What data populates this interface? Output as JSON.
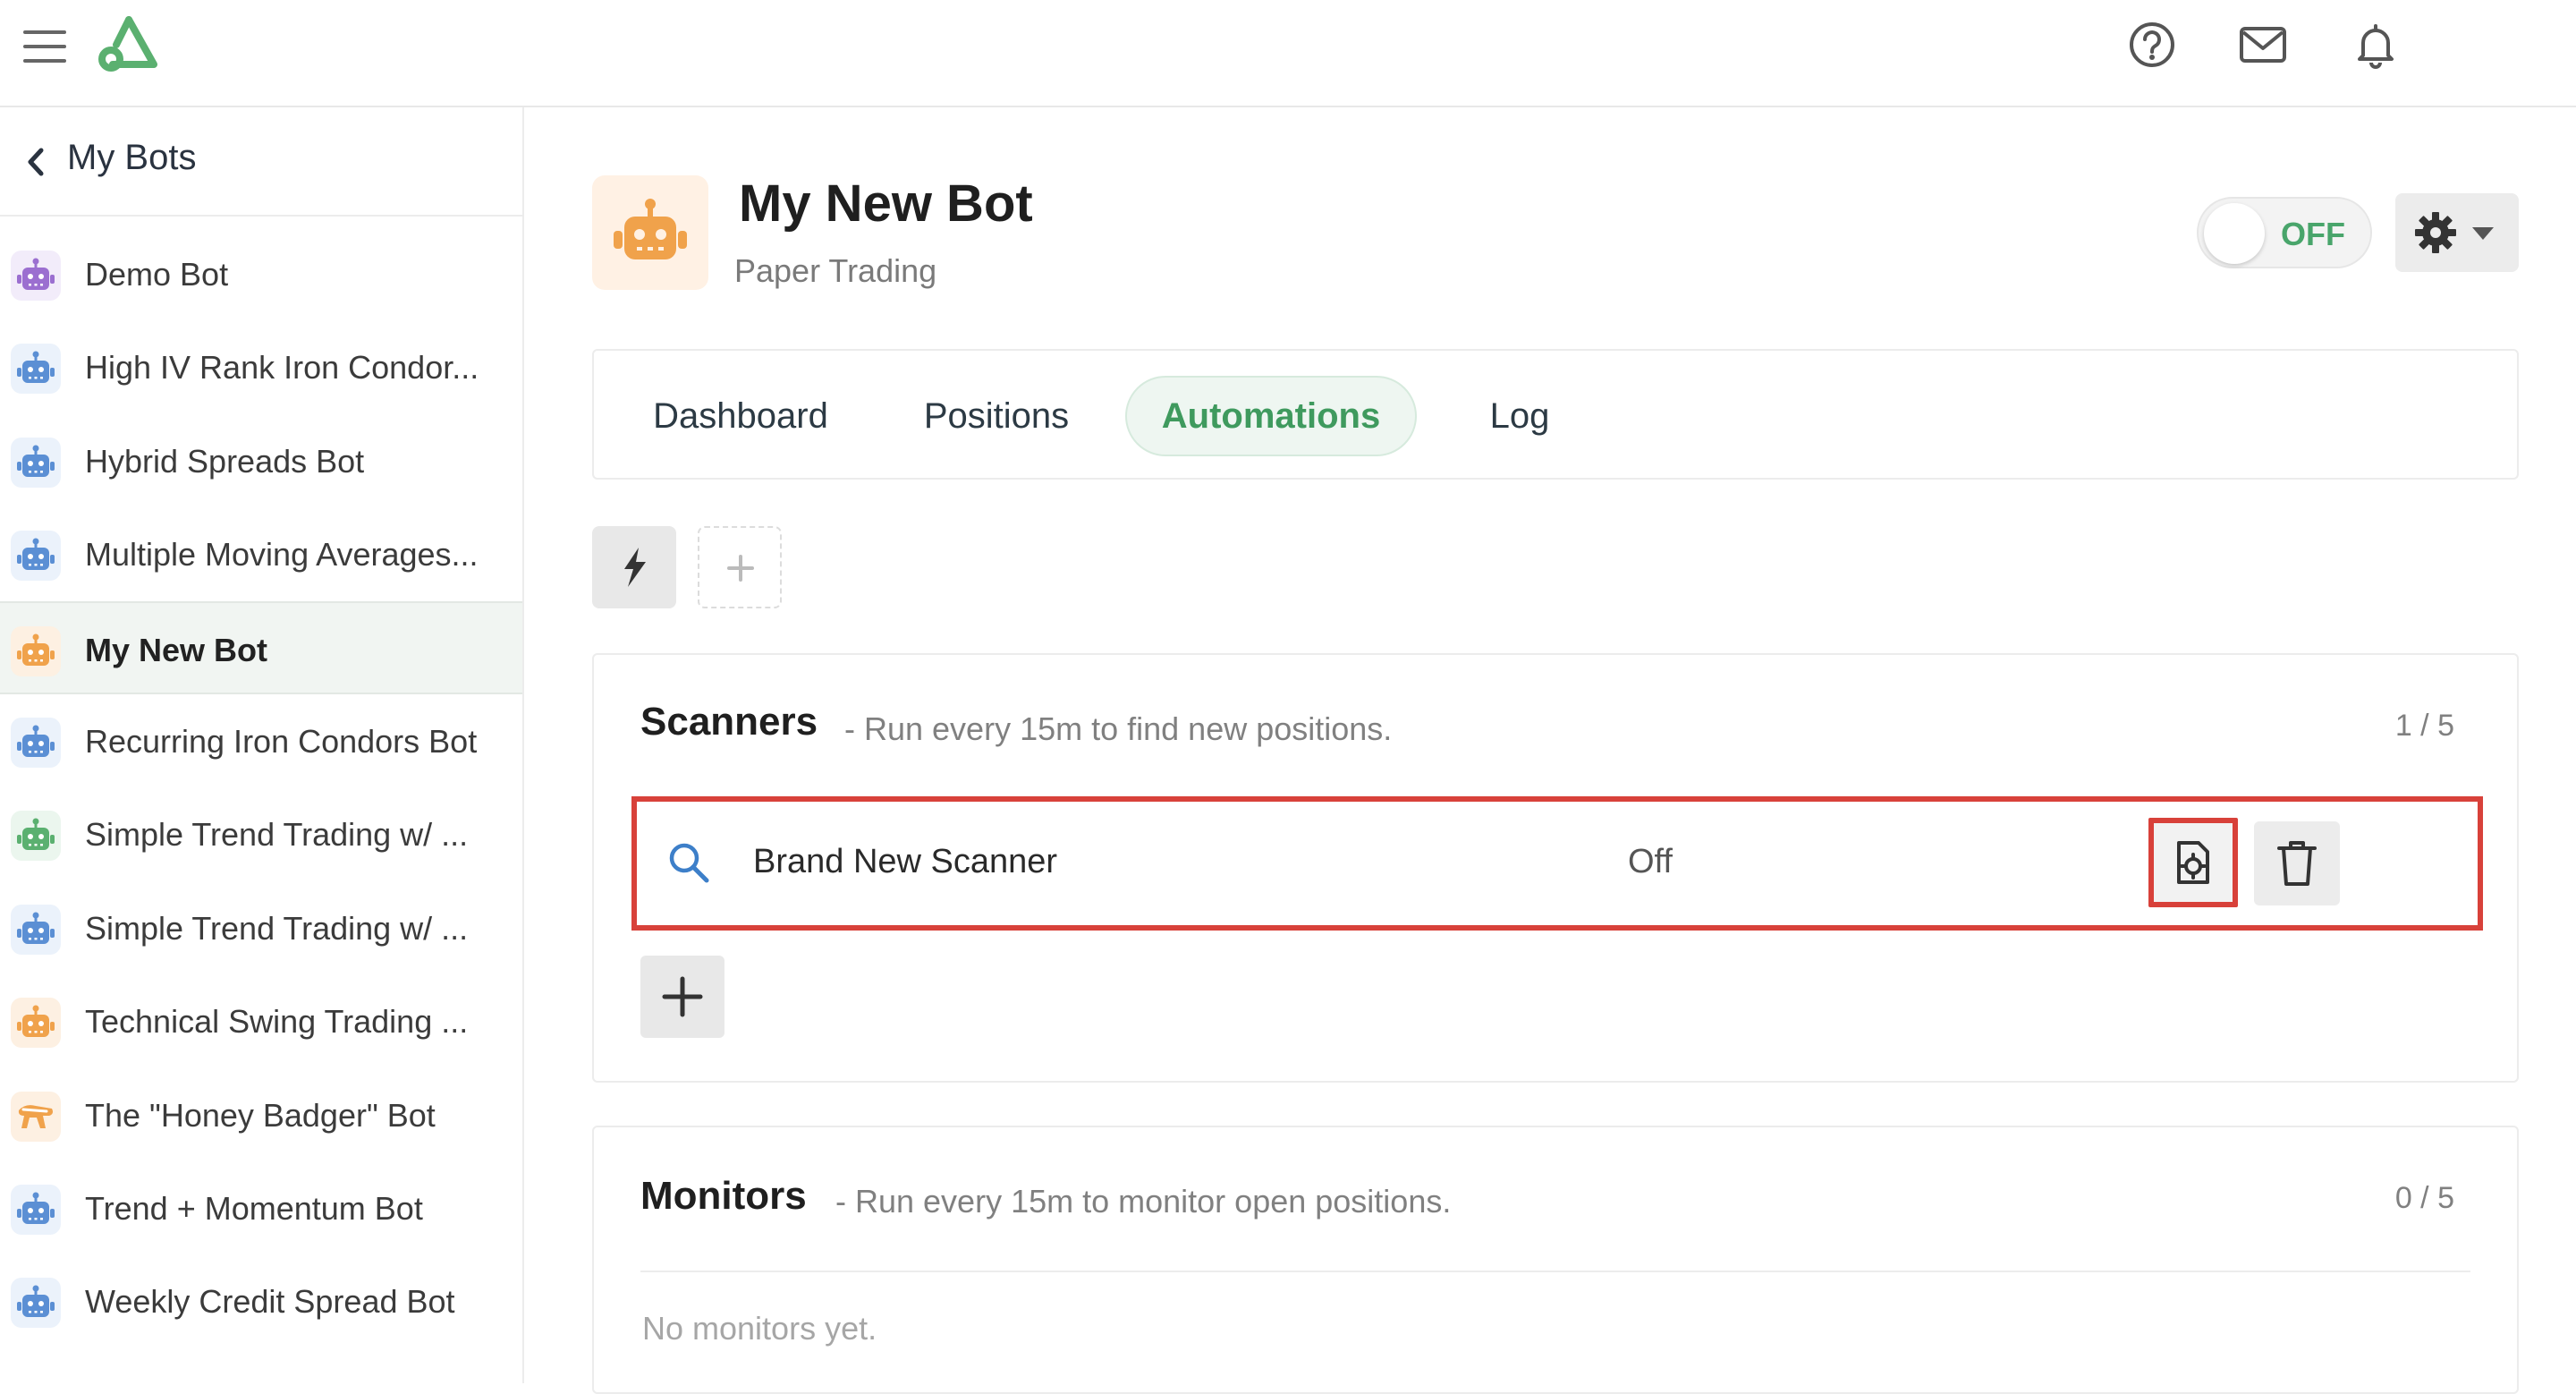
{
  "topbar": {
    "icons": [
      "menu-icon",
      "logo",
      "help-icon",
      "mail-icon",
      "bell-icon"
    ]
  },
  "sidebar": {
    "back_label": "My Bots",
    "items": [
      {
        "label": "Demo Bot",
        "icon": "robot-icon",
        "color": "#9b6fd0",
        "bg": "#f2ecfa"
      },
      {
        "label": "High IV Rank Iron Condor...",
        "icon": "robot-icon",
        "color": "#5b8fd4",
        "bg": "#ebf2fb"
      },
      {
        "label": "Hybrid Spreads Bot",
        "icon": "robot-icon",
        "color": "#5b8fd4",
        "bg": "#ebf2fb"
      },
      {
        "label": "Multiple Moving Averages...",
        "icon": "robot-icon",
        "color": "#5b8fd4",
        "bg": "#ebf2fb"
      },
      {
        "label": "My New Bot",
        "icon": "robot-icon",
        "color": "#f0a24b",
        "bg": "#fdf0e2",
        "selected": true
      },
      {
        "label": "Recurring Iron Condors Bot",
        "icon": "robot-icon",
        "color": "#5b8fd4",
        "bg": "#ebf2fb"
      },
      {
        "label": "Simple Trend Trading w/ ...",
        "icon": "robot-icon",
        "color": "#5bb070",
        "bg": "#ebf6ee"
      },
      {
        "label": "Simple Trend Trading w/ ...",
        "icon": "robot-icon",
        "color": "#5b8fd4",
        "bg": "#ebf2fb"
      },
      {
        "label": "Technical Swing Trading ...",
        "icon": "robot-icon",
        "color": "#f0a24b",
        "bg": "#fdf0e2"
      },
      {
        "label": "The \"Honey Badger\" Bot",
        "icon": "badger-icon",
        "color": "#f0a24b",
        "bg": "#fdf0e2"
      },
      {
        "label": "Trend + Momentum Bot",
        "icon": "robot-icon",
        "color": "#5b8fd4",
        "bg": "#ebf2fb"
      },
      {
        "label": "Weekly Credit Spread Bot",
        "icon": "robot-icon",
        "color": "#5b8fd4",
        "bg": "#ebf2fb"
      }
    ]
  },
  "bot": {
    "name": "My New Bot",
    "mode": "Paper Trading",
    "toggle_label": "OFF",
    "accent": "#49a56b"
  },
  "tabs": [
    {
      "label": "Dashboard"
    },
    {
      "label": "Positions"
    },
    {
      "label": "Automations",
      "active": true
    },
    {
      "label": "Log"
    }
  ],
  "scanners": {
    "title": "Scanners",
    "description": "- Run every 15m to find new positions.",
    "count": "1 / 5",
    "rows": [
      {
        "name": "Brand New Scanner",
        "status": "Off"
      }
    ]
  },
  "monitors": {
    "title": "Monitors",
    "description": "- Run every 15m to monitor open positions.",
    "count": "0 / 5",
    "empty_text": "No monitors yet."
  }
}
